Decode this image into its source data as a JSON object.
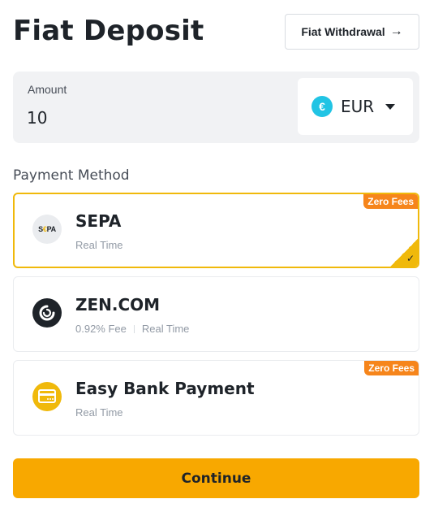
{
  "header": {
    "title": "Fiat Deposit",
    "withdraw_label": "Fiat Withdrawal",
    "withdraw_arrow": "→"
  },
  "amount": {
    "label": "Amount",
    "value": "10",
    "currency_symbol": "€",
    "currency_code": "EUR"
  },
  "payment": {
    "section_label": "Payment Method",
    "methods": [
      {
        "name": "SEPA",
        "icon": "sepa-logo-icon",
        "logo_text_a": "S",
        "logo_text_e": "€",
        "logo_text_b": "PA",
        "meta": [
          "Real Time"
        ],
        "badge": "Zero Fees",
        "selected": true
      },
      {
        "name": "ZEN.COM",
        "icon": "zen-logo-icon",
        "meta": [
          "0.92% Fee",
          "Real Time"
        ],
        "badge": "",
        "selected": false
      },
      {
        "name": "Easy Bank Payment",
        "icon": "bank-card-icon",
        "meta": [
          "Real Time"
        ],
        "badge": "Zero Fees",
        "selected": false
      }
    ]
  },
  "continue_label": "Continue",
  "colors": {
    "accent": "#f0b90b",
    "button": "#f8a800",
    "badge": "#f6851b",
    "euro": "#21c4e4"
  }
}
